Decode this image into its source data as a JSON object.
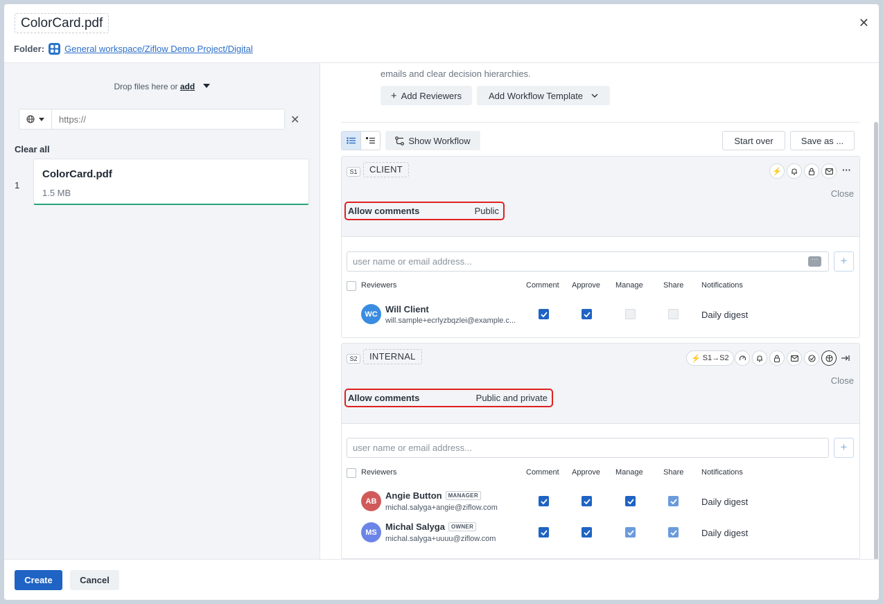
{
  "header": {
    "title": "ColorCard.pdf",
    "folder_label": "Folder:",
    "folder_path": "General workspace/Ziflow Demo Project/Digital",
    "close_icon": "close-icon"
  },
  "upload": {
    "drop_text": "Drop files here or",
    "add_link": "add",
    "url_placeholder": "https://",
    "clear_all": "Clear all",
    "files": [
      {
        "index": "1",
        "name": "ColorCard.pdf",
        "size": "1.5 MB"
      }
    ]
  },
  "workflow": {
    "intro": "emails and clear decision hierarchies.",
    "add_reviewers": "Add Reviewers",
    "add_template": "Add Workflow Template",
    "show_workflow": "Show Workflow",
    "start_over": "Start over",
    "save_as": "Save as ...",
    "columns": {
      "reviewers": "Reviewers",
      "comment": "Comment",
      "approve": "Approve",
      "manage": "Manage",
      "share": "Share",
      "notifications": "Notifications"
    },
    "stages": [
      {
        "badge": "S1",
        "name": "CLIENT",
        "close": "Close",
        "allow_label": "Allow comments",
        "allow_value": "Public",
        "input_placeholder": "user name or email address...",
        "reviewers": [
          {
            "initials": "WC",
            "color": "#3b8ce0",
            "name": "Will Client",
            "role": "",
            "email": "will.sample+ecrlyzbqzlei@example.c...",
            "comment": "on",
            "approve": "on",
            "manage": "off",
            "share": "off",
            "notifications": "Daily digest"
          }
        ]
      },
      {
        "badge": "S2",
        "name": "INTERNAL",
        "flow": "S1→S2",
        "close": "Close",
        "allow_label": "Allow comments",
        "allow_value": "Public and private",
        "input_placeholder": "user name or email address...",
        "reviewers": [
          {
            "initials": "AB",
            "color": "#d05a5a",
            "name": "Angie Button",
            "role": "MANAGER",
            "email": "michal.salyga+angie@ziflow.com",
            "comment": "on",
            "approve": "on",
            "manage": "on",
            "share": "light",
            "notifications": "Daily digest"
          },
          {
            "initials": "MS",
            "color": "#6b84e8",
            "name": "Michal Salyga",
            "role": "OWNER",
            "email": "michal.salyga+uuuu@ziflow.com",
            "comment": "on",
            "approve": "on",
            "manage": "light",
            "share": "light",
            "notifications": "Daily digest"
          }
        ]
      }
    ]
  },
  "footer": {
    "create": "Create",
    "cancel": "Cancel"
  },
  "colors": {
    "primary": "#1f63c4",
    "highlight_border": "#e02020",
    "file_progress": "#27a27a"
  }
}
